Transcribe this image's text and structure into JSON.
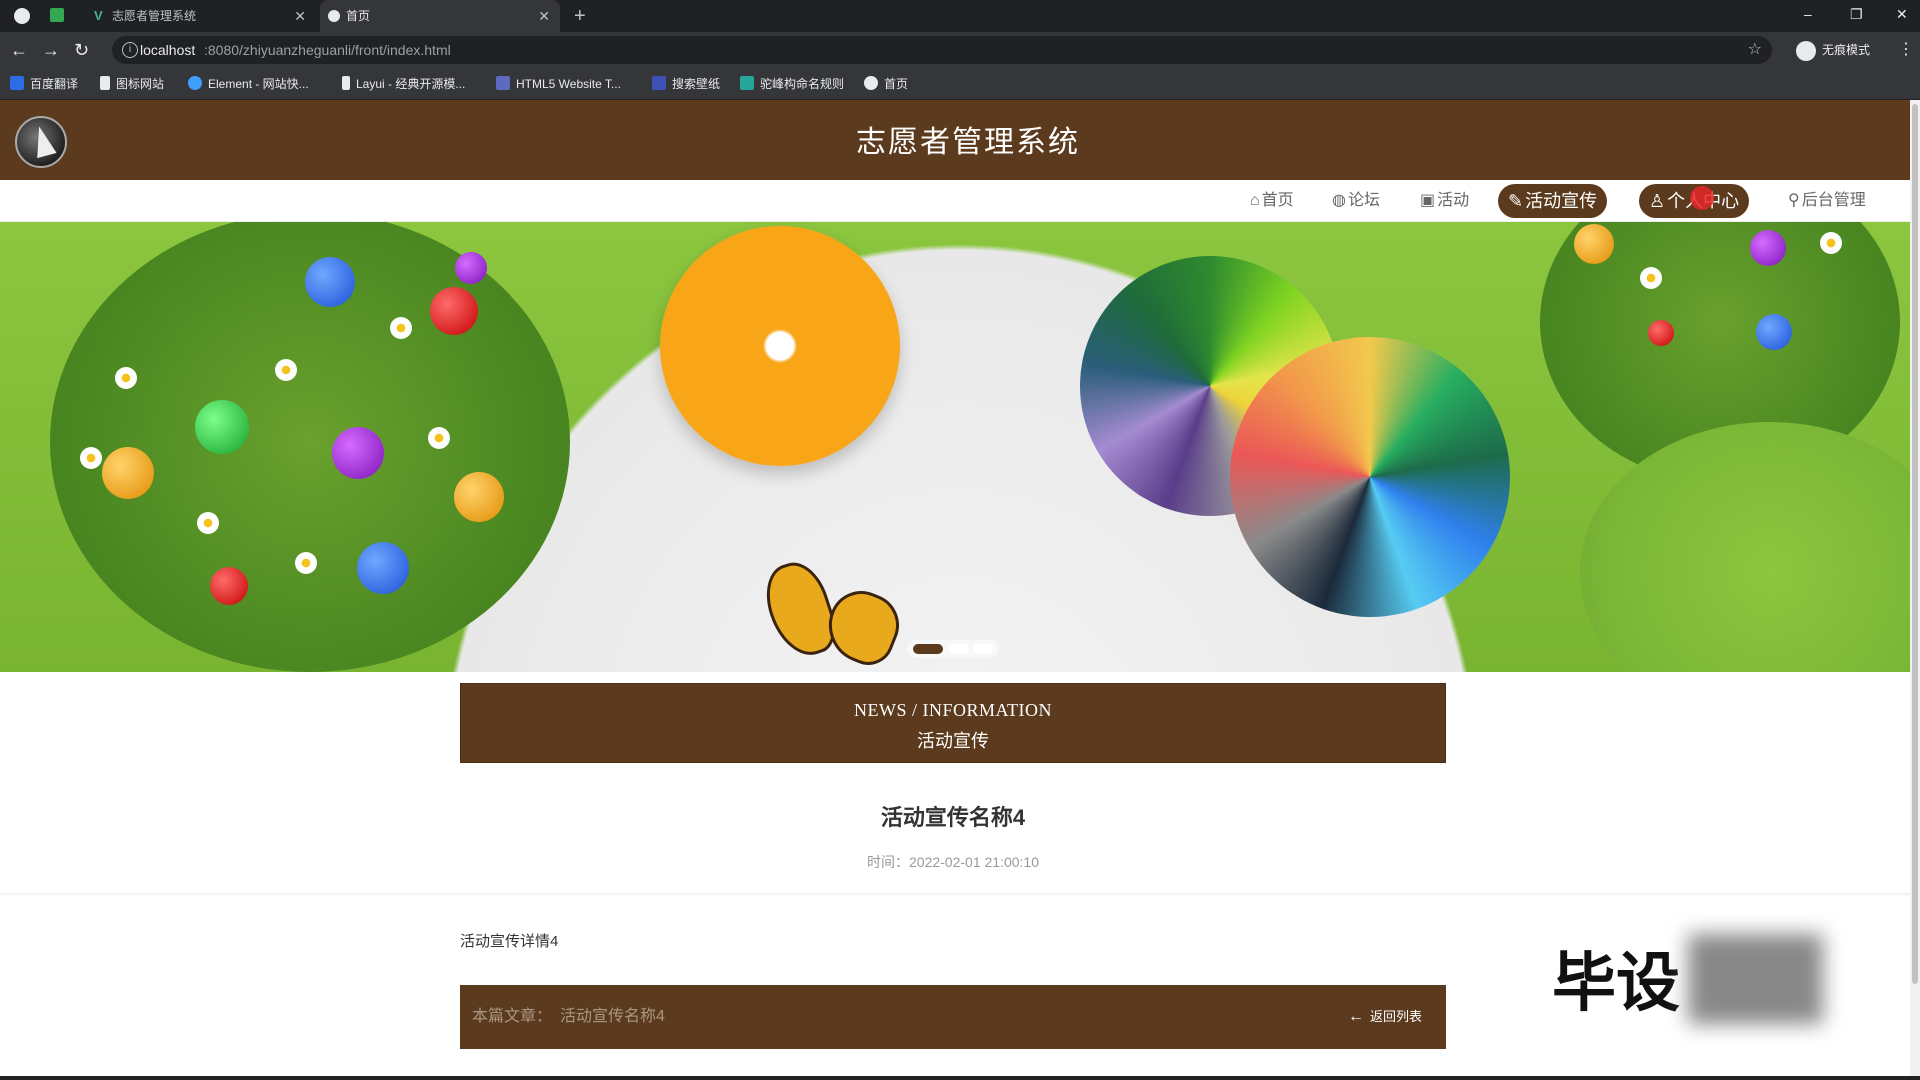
{
  "browser": {
    "tabs": [
      {
        "label": "志愿者管理系统"
      },
      {
        "label": "首页"
      }
    ],
    "url_host": "localhost",
    "url_path": ":8080/zhiyuanzheguanli/front/index.html",
    "profile_label": "无痕模式",
    "bookmarks": [
      {
        "label": "百度翻译",
        "color": "#2b6de5"
      },
      {
        "label": "图标网站",
        "color": "#e8eaed"
      },
      {
        "label": "Element - 网站快...",
        "color": "#409eff"
      },
      {
        "label": "Layui - 经典开源模...",
        "color": "#e8eaed"
      },
      {
        "label": "HTML5 Website T...",
        "color": "#5c6bc0"
      },
      {
        "label": "搜索壁纸",
        "color": "#3f51b5"
      },
      {
        "label": "驼峰构命名规则",
        "color": "#26a69a"
      },
      {
        "label": "首页",
        "color": "#e8eaed"
      }
    ]
  },
  "site": {
    "title": "志愿者管理系统",
    "brand_color": "#5b3a1d"
  },
  "nav": {
    "items": [
      {
        "label": "首页",
        "icon": "home-icon",
        "glyph": "⌂"
      },
      {
        "label": "论坛",
        "icon": "forum-icon",
        "glyph": "◍"
      },
      {
        "label": "活动",
        "icon": "activity-icon",
        "glyph": "▣"
      },
      {
        "label": "活动宣传",
        "icon": "tag-icon",
        "glyph": "✎"
      },
      {
        "label": "个人中心",
        "icon": "user-icon",
        "glyph": "♙"
      },
      {
        "label": "后台管理",
        "icon": "link-icon",
        "glyph": "⚲"
      }
    ],
    "active": "活动宣传",
    "highlighted": "个人中心"
  },
  "section": {
    "title_en": "NEWS / INFORMATION",
    "title_cn": "活动宣传"
  },
  "article": {
    "title": "活动宣传名称4",
    "time_label": "时间：",
    "time_value": "2022-02-01 21:00:10",
    "body": "活动宣传详情4"
  },
  "footer": {
    "current_label": "本篇文章：",
    "current_value": "活动宣传名称4",
    "back_label": "返回列表"
  },
  "carousel": {
    "slide_count": 3,
    "active_index": 0
  },
  "watermark": {
    "text": "毕设"
  }
}
